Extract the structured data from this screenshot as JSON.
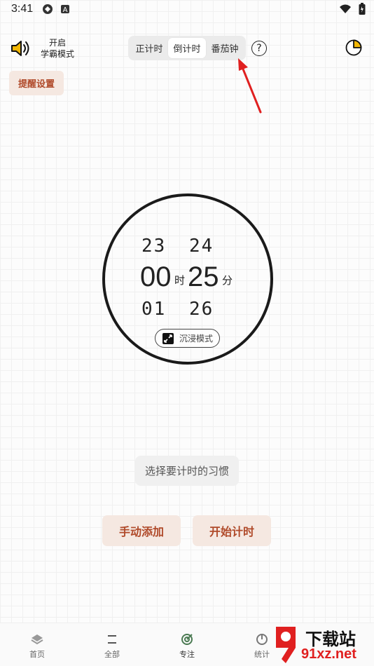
{
  "status": {
    "time": "3:41"
  },
  "top": {
    "xueba_line1": "开启",
    "xueba_line2": "学霸模式",
    "tabs": [
      {
        "label": "正计时"
      },
      {
        "label": "倒计时"
      },
      {
        "label": "番茄钟"
      }
    ],
    "help": "?"
  },
  "remind": "提醒设置",
  "clock": {
    "prev_hour": "23",
    "prev_minute": "24",
    "hour": "00",
    "hour_unit": "时",
    "minute": "25",
    "minute_unit": "分",
    "next_hour": "01",
    "next_minute": "26",
    "immersive": "沉浸模式"
  },
  "habit_placeholder": "选择要计时的习惯",
  "actions": {
    "manual": "手动添加",
    "start": "开始计时"
  },
  "nav": [
    {
      "label": "首页"
    },
    {
      "label": "全部"
    },
    {
      "label": "专注"
    },
    {
      "label": "统计"
    }
  ],
  "watermark": {
    "brand": "下载站",
    "site": "91xz.net"
  },
  "colors": {
    "accent": "#b04a2a",
    "accent_bg": "#f5e8e1",
    "annotation": "#e02020"
  }
}
